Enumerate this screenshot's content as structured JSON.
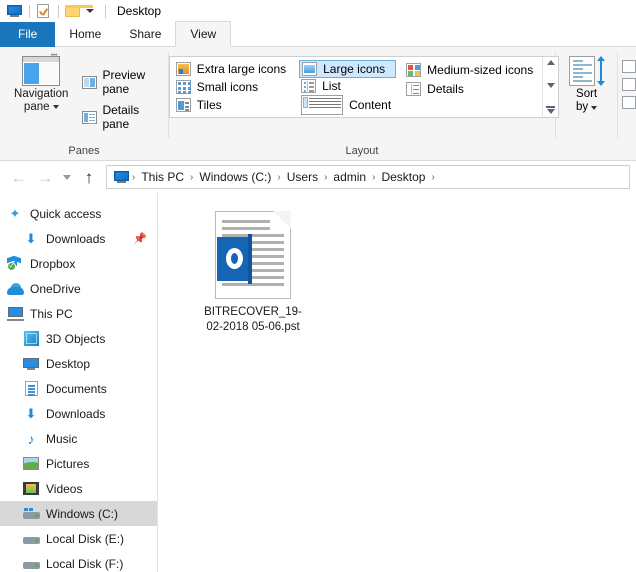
{
  "titlebar": {
    "icons": [
      "monitor-icon",
      "properties-icon",
      "folder-icon",
      "customize-chevron-icon"
    ],
    "title": "Desktop"
  },
  "ribbon": {
    "tabs": [
      {
        "label": "File",
        "active": false,
        "primary": true
      },
      {
        "label": "Home",
        "active": false
      },
      {
        "label": "Share",
        "active": false
      },
      {
        "label": "View",
        "active": true
      }
    ],
    "panes": {
      "group_label": "Panes",
      "navigation_pane": "Navigation\npane",
      "navigation_pane_line1": "Navigation",
      "navigation_pane_line2": "pane",
      "preview_pane": "Preview pane",
      "details_pane": "Details pane"
    },
    "layout": {
      "group_label": "Layout",
      "items": [
        {
          "label": "Extra large icons",
          "selected": false
        },
        {
          "label": "Small icons",
          "selected": false
        },
        {
          "label": "Tiles",
          "selected": false
        },
        {
          "label": "Large icons",
          "selected": true
        },
        {
          "label": "List",
          "selected": false
        },
        {
          "label": "Content",
          "selected": false
        },
        {
          "label": "Medium-sized icons",
          "selected": false
        },
        {
          "label": "Details",
          "selected": false
        }
      ]
    },
    "sort": {
      "line1": "Sort",
      "line2": "by"
    }
  },
  "addressbar": {
    "back": "←",
    "forward": "→",
    "up": "↑",
    "crumbs": [
      "This PC",
      "Windows (C:)",
      "Users",
      "admin",
      "Desktop"
    ],
    "separator": "›"
  },
  "sidebar": {
    "items": [
      {
        "label": "Quick access",
        "icon": "star-icon",
        "indent": 0,
        "selected": false,
        "pinned": false
      },
      {
        "label": "Downloads",
        "icon": "download-arrow-icon",
        "indent": 1,
        "selected": false,
        "pinned": true
      },
      {
        "label": "Dropbox",
        "icon": "dropbox-icon",
        "indent": 0,
        "selected": false,
        "pinned": false
      },
      {
        "label": "OneDrive",
        "icon": "onedrive-cloud-icon",
        "indent": 0,
        "selected": false,
        "pinned": false
      },
      {
        "label": "This PC",
        "icon": "this-pc-icon",
        "indent": 0,
        "selected": false,
        "pinned": false
      },
      {
        "label": "3D Objects",
        "icon": "3d-objects-icon",
        "indent": 1,
        "selected": false,
        "pinned": false
      },
      {
        "label": "Desktop",
        "icon": "desktop-icon",
        "indent": 1,
        "selected": false,
        "pinned": false
      },
      {
        "label": "Documents",
        "icon": "documents-icon",
        "indent": 1,
        "selected": false,
        "pinned": false
      },
      {
        "label": "Downloads",
        "icon": "download-arrow-icon",
        "indent": 1,
        "selected": false,
        "pinned": false
      },
      {
        "label": "Music",
        "icon": "music-note-icon",
        "indent": 1,
        "selected": false,
        "pinned": false
      },
      {
        "label": "Pictures",
        "icon": "pictures-icon",
        "indent": 1,
        "selected": false,
        "pinned": false
      },
      {
        "label": "Videos",
        "icon": "videos-icon",
        "indent": 1,
        "selected": false,
        "pinned": false
      },
      {
        "label": "Windows (C:)",
        "icon": "windows-drive-icon",
        "indent": 1,
        "selected": true,
        "pinned": false
      },
      {
        "label": "Local Disk (E:)",
        "icon": "drive-icon",
        "indent": 1,
        "selected": false,
        "pinned": false
      },
      {
        "label": "Local Disk (F:)",
        "icon": "drive-icon",
        "indent": 1,
        "selected": false,
        "pinned": false
      }
    ],
    "pin_glyph": "📌"
  },
  "content": {
    "files": [
      {
        "name_line1": "BITRECOVER_19-",
        "name_line2": "02-2018 05-06.pst",
        "full_name": "BITRECOVER_19-02-2018 05-06.pst",
        "icon": "outlook-pst-file-icon",
        "icon_letter": "O"
      }
    ]
  },
  "colors": {
    "accent_blue": "#1b75bb",
    "selection_blue": "#cde8ff",
    "outlook_blue": "#1664b4",
    "ribbon_bg": "#f5f5f5",
    "sidebar_selected": "#d8d8d8"
  }
}
